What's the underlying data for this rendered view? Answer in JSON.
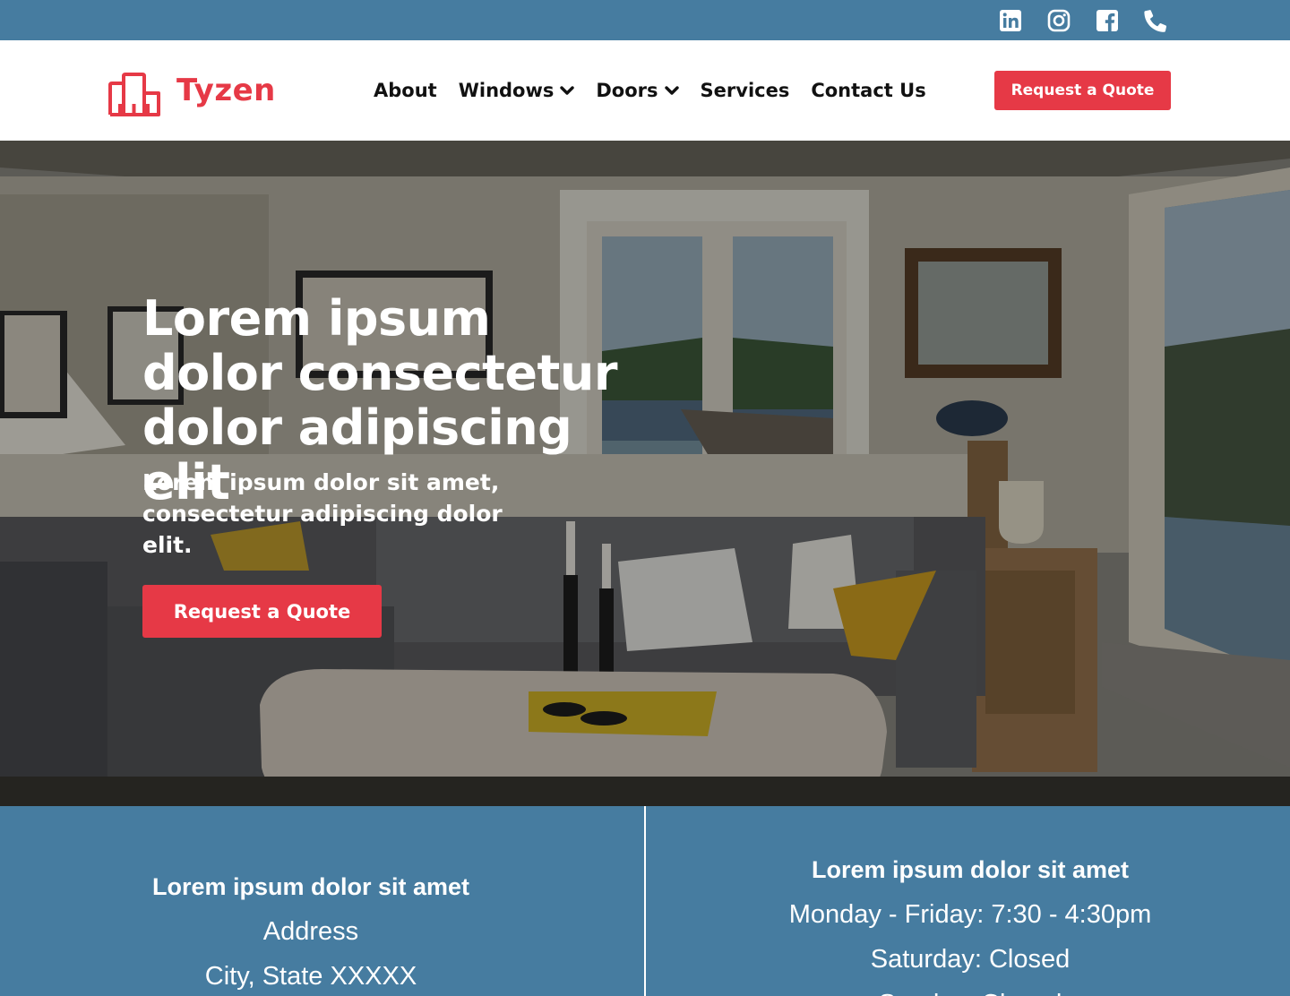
{
  "brand": {
    "name": "Tyzen",
    "logo_icon": "bar-chart-logo-icon",
    "colors": {
      "accent": "#e63946",
      "band": "#467ca0",
      "header_bg": "#ffffff"
    }
  },
  "social": [
    {
      "name": "linkedin-icon"
    },
    {
      "name": "instagram-icon"
    },
    {
      "name": "facebook-icon"
    },
    {
      "name": "phone-icon"
    }
  ],
  "nav": {
    "items": [
      {
        "label": "About",
        "has_dropdown": false
      },
      {
        "label": "Windows",
        "has_dropdown": true
      },
      {
        "label": "Doors",
        "has_dropdown": true
      },
      {
        "label": "Services",
        "has_dropdown": false
      },
      {
        "label": "Contact Us",
        "has_dropdown": false
      }
    ],
    "cta_label": "Request a Quote"
  },
  "hero": {
    "title": "Lorem ipsum dolor consectetur dolor adipiscing elit",
    "subtitle": "Lorem ipsum dolor sit amet, consectetur adipiscing dolor elit.",
    "cta_label": "Request a Quote",
    "background": "living-room-photo"
  },
  "info": {
    "left": {
      "title": "Lorem ipsum dolor sit amet",
      "lines": [
        "Address",
        "City, State XXXXX"
      ]
    },
    "right": {
      "title": "Lorem ipsum dolor sit amet",
      "lines": [
        "Monday - Friday: 7:30 - 4:30pm",
        "Saturday: Closed",
        "Sunday: Closed"
      ]
    }
  }
}
